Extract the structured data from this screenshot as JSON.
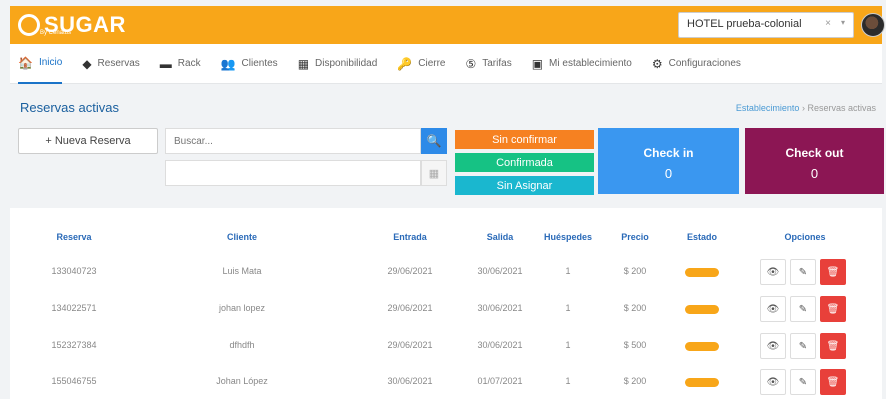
{
  "app": {
    "name": "SUGAR",
    "tagline": "By Cenatus"
  },
  "header": {
    "hotel_selected": "HOTEL prueba-colonial",
    "clear_glyph": "×",
    "caret_glyph": "▾"
  },
  "nav": [
    {
      "label": "Inicio",
      "icon": "home-icon",
      "glyph": "🏠",
      "active": true
    },
    {
      "label": "Reservas",
      "icon": "tag-icon",
      "glyph": "◆"
    },
    {
      "label": "Rack",
      "icon": "bed-icon",
      "glyph": "▬"
    },
    {
      "label": "Clientes",
      "icon": "people-icon",
      "glyph": "👥"
    },
    {
      "label": "Disponibilidad",
      "icon": "grid-icon",
      "glyph": "▦"
    },
    {
      "label": "Cierre",
      "icon": "key-icon",
      "glyph": "🔑"
    },
    {
      "label": "Tarifas",
      "icon": "coin-icon",
      "glyph": "⑤"
    },
    {
      "label": "Mi establecimiento",
      "icon": "building-icon",
      "glyph": "▣"
    },
    {
      "label": "Configuraciones",
      "icon": "settings-icon",
      "glyph": "⚙"
    }
  ],
  "page": {
    "title": "Reservas activas",
    "breadcrumb": {
      "link": "Establecimiento",
      "sep": "›",
      "current": "Reservas activas"
    }
  },
  "controls": {
    "new_button": "+ Nueva Reserva",
    "search_placeholder": "Buscar...",
    "search_glyph": "🔍",
    "calendar_glyph": "▦"
  },
  "statuses": {
    "unconfirmed": "Sin confirmar",
    "confirmed": "Confirmada",
    "unassigned": "Sin Asignar"
  },
  "cards": {
    "checkin": {
      "label": "Check in",
      "value": "0",
      "color": "#3a97f0"
    },
    "checkout": {
      "label": "Check out",
      "value": "0",
      "color": "#8c1654"
    }
  },
  "table": {
    "headers": [
      "Reserva",
      "Cliente",
      "Entrada",
      "Salida",
      "Huéspedes",
      "Precio",
      "Estado",
      "Opciones"
    ],
    "rows": [
      {
        "reserva": "133040723",
        "cliente": "Luis Mata",
        "entrada": "29/06/2021",
        "salida": "30/06/2021",
        "huespedes": "1",
        "precio": "$ 200"
      },
      {
        "reserva": "134022571",
        "cliente": "johan lopez",
        "entrada": "29/06/2021",
        "salida": "30/06/2021",
        "huespedes": "1",
        "precio": "$ 200"
      },
      {
        "reserva": "152327384",
        "cliente": "dfhdfh",
        "entrada": "29/06/2021",
        "salida": "30/06/2021",
        "huespedes": "1",
        "precio": "$ 500"
      },
      {
        "reserva": "155046755",
        "cliente": "Johan López",
        "entrada": "30/06/2021",
        "salida": "01/07/2021",
        "huespedes": "1",
        "precio": "$ 200"
      }
    ],
    "option_glyphs": {
      "view": "👁",
      "edit": "✎",
      "delete": "🗑"
    }
  },
  "colors": {
    "brand": "#f8a619",
    "primary": "#2d8ae8",
    "danger": "#e8403a"
  }
}
